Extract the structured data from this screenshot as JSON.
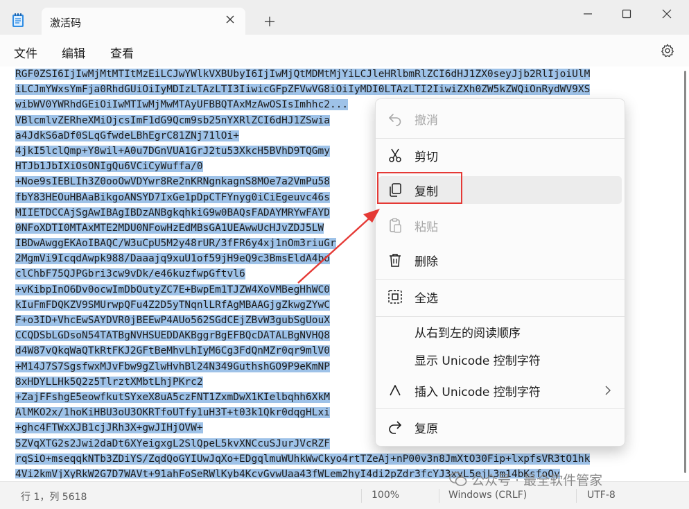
{
  "window": {
    "tab_title": "激活码",
    "icons": [
      "notepad-icon",
      "close-icon",
      "plus-icon",
      "minimize-icon",
      "maximize-icon",
      "close-icon"
    ]
  },
  "menu": {
    "file": "文件",
    "edit": "编辑",
    "view": "查看"
  },
  "editor": {
    "selection_color": "#9ec2e8",
    "lines": [
      "RGF0ZSI6IjIwMjMtMTItMzEiLCJwYWlkVXBUbyI6IjIwMjQtMDMtMjYiLCJleHRlbmRlZCI6dHJ1ZX0seyJjb2RlIjoiUlM",
      "iLCJmYWxsYmFja0RhdGUiOiIyMDIzLTAzLTI3IiwicGFpZFVwVG8iOiIyMDI0LTAzLTI2IiwiZXh0ZW5kZWQiOnRydWV9XS",
      "wibWV0YWRhdGEiOiIwMTIwMjMwMTAyUFBBQTAxMzAwOSIsImhhc2...",
      "VBlcmlvZERheXMiOjcsImF1dG9Qcm9sb25nYXRlZCI6dHJ1ZSwia",
      "a4JdkS6aDf0SLqGfwdeLBhEgrC81ZNj71lOi+",
      "4jkI5lclQmp+Y8wil+A0u7DGnVUA1GrJ2tu53XkcH5BVhD9TQGmy",
      "HTJb1JbIXiOsONIgQu6VCiCyWuffa/0",
      "+Noe9sIEBLIh3Z0ooOwVDYwr8Re2nKRNgnkagnS8MOe7a2VmPu58",
      "fbY83HEOuHBAaBikgoANSYD7IxGe1pDpCTFYnyg0iCiEgeuvc46s",
      "MIIETDCCAjSgAwIBAgIBDzANBgkqhkiG9w0BAQsFADAYMRYwFAYD",
      "0NFoXDTI0MTAxMTE2MDU0NFowHzEdMBsGA1UEAwwUcHJvZDJ5LW",
      "IBDwAwggEKAoIBAQC/W3uCpU5M2y48rUR/3fFR6y4xj1nOm3riuGr",
      "2MgmVi9IcqdAwpk988/Daaajq9xuU1of59jH9eQ9c3BmsEldA4bo",
      "clChbF75QJPGbri3cw9vDk/e46kuzfwpGftvl6",
      "+vKibpInO6Dv0ocwImDbOutyZC7E+BwpEm1TJZW4XoVMBegHhWC0",
      "kIuFmFDQKZV9SMUrwpQFu4Z2D5yTNqnlLRfAgMBAAGjgZkwgZYwC",
      "F+o3ID+VhcEwSAYDVR0jBEEwP4AUo562SGdCEjZBvW3gubSgUouX",
      "CCQDSbLGDsoN54TATBgNVHSUEDDAKBggrBgEFBQcDATALBgNVHQ8",
      "d4W87vQkqWaQTkRtFKJ2GFtBeMhvLhIyM6Cg3FdQnMZr0qr9mlV0",
      "+M14J7S7SgsfwxMJvFbw9gZlwHvhBl24N349GuthshGO9P9eKmNP",
      "8xHDYLLHk5Q2z5TlrztXMbtLhjPKrc2",
      "+ZajFFshgE5eowfkutSYxeX8uA5czFNT1ZxmDwX1KIelbqhh6XkM",
      "AlMKO2x/1hoKiHBU3oU3OKRTfoUTfy1uH3T+t03k1Qkr0dqgHLxi",
      "+ghc4FTWxXJB1cjJRh3X+gwJIHjOVW+",
      "5ZVqXTG2s2Jwi2daDt6XYeigxgL2SlQpeL5kvXNCcuSJurJVcRZF",
      "rqSiO+mseqqkNTb3ZDiYS/ZqdQoGYIUwJqXo+EDgqlmuWUhkWwCkyo4rtTZeAj+nP00v3n8JmXtO30Fip+lxpfsVR3tO1hk",
      "4Vi2kmVjXyRkW2G7D7WAVt+91ahFoSeRWlKyb4KcvGvwUaa43fWLem2hyI4di2pZdr3fcYJ3xvL5ejL3m14bKsfoOy"
    ]
  },
  "context_menu": {
    "undo": "撤消",
    "cut": "剪切",
    "copy": "复制",
    "paste": "粘贴",
    "delete": "删除",
    "select_all": "全选",
    "rtl": "从右到左的阅读顺序",
    "show_unicode": "显示 Unicode 控制字符",
    "insert_unicode": "插入 Unicode 控制字符",
    "reconversion": "复原"
  },
  "status": {
    "position": "行 1，列 5618",
    "zoom": "100%",
    "line_ending": "Windows (CRLF)",
    "encoding": "UTF-8"
  },
  "watermark": {
    "text": "公众号 · 最全软件管家"
  },
  "colors": {
    "annotation_red": "#e53935"
  }
}
